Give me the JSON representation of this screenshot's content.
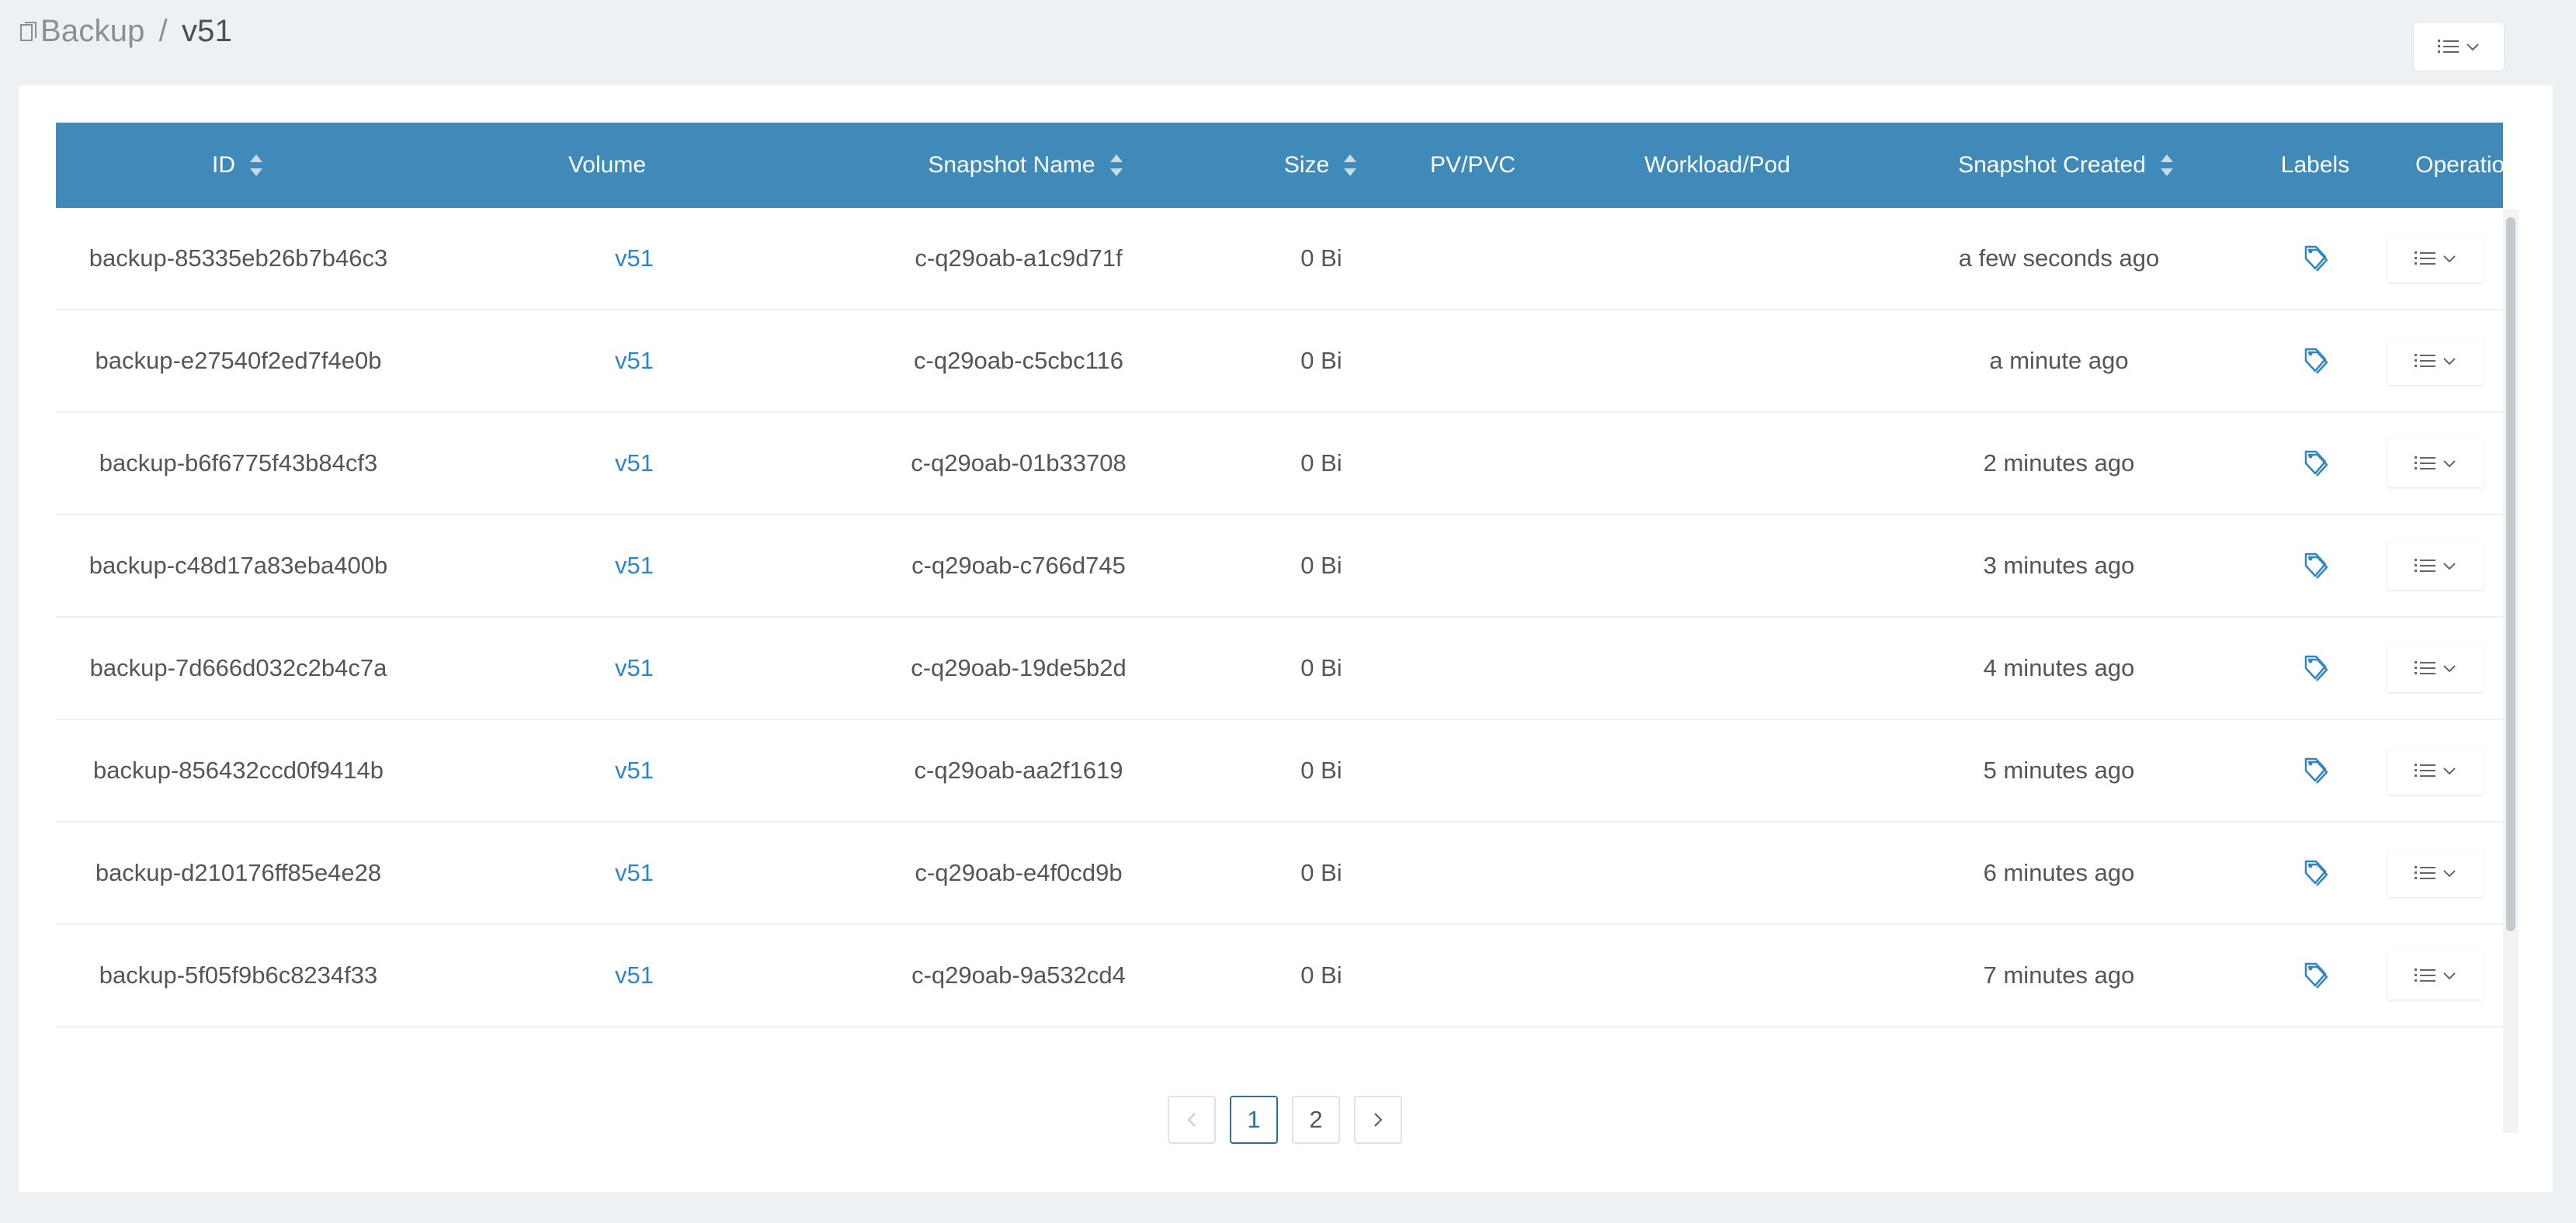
{
  "breadcrumb": {
    "root": "Backup",
    "separator": "/",
    "current": "v51"
  },
  "table": {
    "columns": [
      {
        "key": "id",
        "label": "ID",
        "sortable": true
      },
      {
        "key": "volume",
        "label": "Volume",
        "sortable": false
      },
      {
        "key": "snapshot",
        "label": "Snapshot Name",
        "sortable": true
      },
      {
        "key": "size",
        "label": "Size",
        "sortable": true
      },
      {
        "key": "pvpvc",
        "label": "PV/PVC",
        "sortable": false
      },
      {
        "key": "workload",
        "label": "Workload/Pod",
        "sortable": false
      },
      {
        "key": "created",
        "label": "Snapshot Created",
        "sortable": true
      },
      {
        "key": "labels",
        "label": "Labels",
        "sortable": false
      },
      {
        "key": "operation",
        "label": "Operation",
        "sortable": false
      }
    ],
    "rows": [
      {
        "id": "backup-85335eb26b7b46c3",
        "volume": "v51",
        "snapshot": "c-q29oab-a1c9d71f",
        "size": "0 Bi",
        "pvpvc": "",
        "workload": "",
        "created": "a few seconds ago"
      },
      {
        "id": "backup-e27540f2ed7f4e0b",
        "volume": "v51",
        "snapshot": "c-q29oab-c5cbc116",
        "size": "0 Bi",
        "pvpvc": "",
        "workload": "",
        "created": "a minute ago"
      },
      {
        "id": "backup-b6f6775f43b84cf3",
        "volume": "v51",
        "snapshot": "c-q29oab-01b33708",
        "size": "0 Bi",
        "pvpvc": "",
        "workload": "",
        "created": "2 minutes ago"
      },
      {
        "id": "backup-c48d17a83eba400b",
        "volume": "v51",
        "snapshot": "c-q29oab-c766d745",
        "size": "0 Bi",
        "pvpvc": "",
        "workload": "",
        "created": "3 minutes ago"
      },
      {
        "id": "backup-7d666d032c2b4c7a",
        "volume": "v51",
        "snapshot": "c-q29oab-19de5b2d",
        "size": "0 Bi",
        "pvpvc": "",
        "workload": "",
        "created": "4 minutes ago"
      },
      {
        "id": "backup-856432ccd0f9414b",
        "volume": "v51",
        "snapshot": "c-q29oab-aa2f1619",
        "size": "0 Bi",
        "pvpvc": "",
        "workload": "",
        "created": "5 minutes ago"
      },
      {
        "id": "backup-d210176ff85e4e28",
        "volume": "v51",
        "snapshot": "c-q29oab-e4f0cd9b",
        "size": "0 Bi",
        "pvpvc": "",
        "workload": "",
        "created": "6 minutes ago"
      },
      {
        "id": "backup-5f05f9b6c8234f33",
        "volume": "v51",
        "snapshot": "c-q29oab-9a532cd4",
        "size": "0 Bi",
        "pvpvc": "",
        "workload": "",
        "created": "7 minutes ago"
      }
    ]
  },
  "pagination": {
    "prev_icon": "chevron-left-icon",
    "next_icon": "chevron-right-icon",
    "pages": [
      "1",
      "2"
    ],
    "current": "1"
  },
  "icons": {
    "breadcrumb": "copy-icon",
    "labels": "tag-icon",
    "operation": "list-icon",
    "dropdown": "chevron-down-icon"
  },
  "colors": {
    "header_bg": "#3f8ab8",
    "link": "#2f86c6",
    "page_bg": "#eef1f3"
  }
}
